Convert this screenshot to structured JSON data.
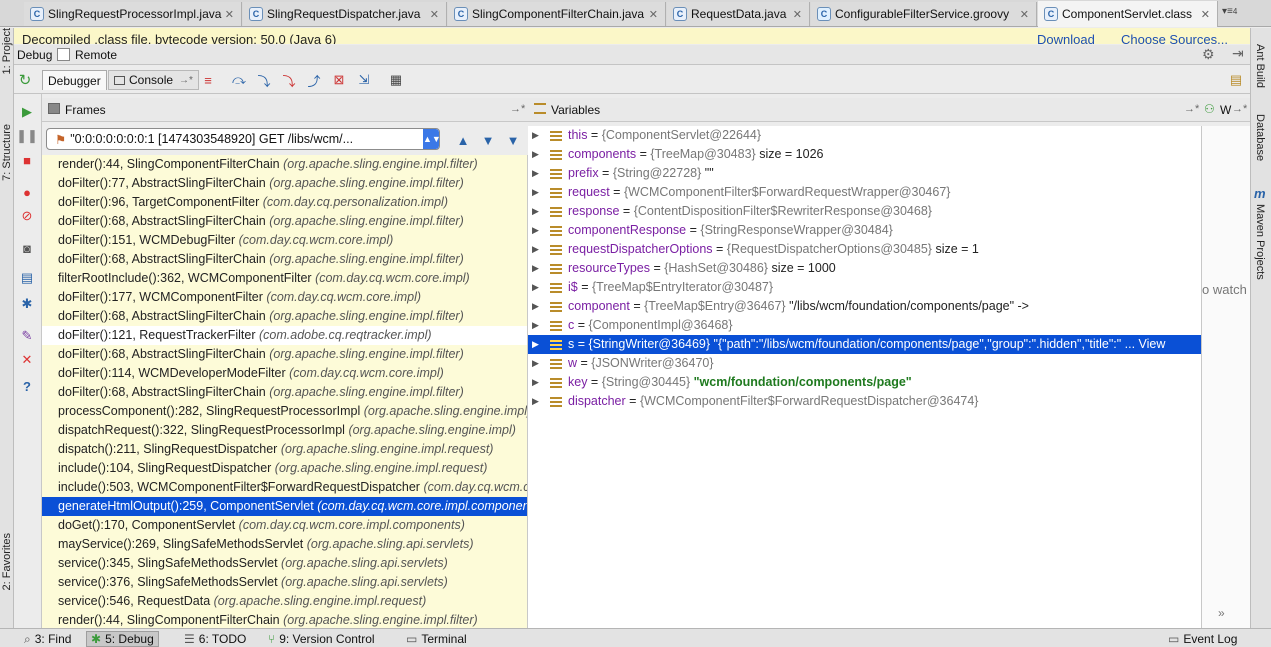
{
  "tabs": [
    {
      "label": "SlingRequestProcessorImpl.java",
      "icon": "class-icon",
      "active": false
    },
    {
      "label": "SlingRequestDispatcher.java",
      "icon": "class-icon",
      "active": false
    },
    {
      "label": "SlingComponentFilterChain.java",
      "icon": "class-icon",
      "active": false
    },
    {
      "label": "RequestData.java",
      "icon": "class-icon",
      "active": false
    },
    {
      "label": "ConfigurableFilterService.groovy",
      "icon": "groovy-class-icon",
      "active": false
    },
    {
      "label": "ComponentServlet.class",
      "icon": "class-file-icon",
      "active": true
    }
  ],
  "tab_overflow": "4",
  "banner": {
    "text": "Decompiled .class file, bytecode version: 50.0 (Java 6)",
    "download": "Download",
    "choose_sources": "Choose Sources..."
  },
  "left_strip": {
    "project": "1: Project",
    "structure": "7: Structure",
    "favorites": "2: Favorites"
  },
  "right_strip": {
    "ant": "Ant Build",
    "database": "Database",
    "maven": "Maven Projects"
  },
  "debug_header": {
    "label": "Debug",
    "config": "Remote"
  },
  "toolbar": {
    "debugger_tab": "Debugger",
    "console_tab": "Console"
  },
  "frames_panel": {
    "title": "Frames",
    "thread": "\"0:0:0:0:0:0:0:1 [1474303548920] GET /libs/wcm/...",
    "rows": [
      {
        "method": "render():44, SlingComponentFilterChain",
        "pkg": "(org.apache.sling.engine.impl.filter)"
      },
      {
        "method": "doFilter():77, AbstractSlingFilterChain",
        "pkg": "(org.apache.sling.engine.impl.filter)"
      },
      {
        "method": "doFilter():96, TargetComponentFilter",
        "pkg": "(com.day.cq.personalization.impl)"
      },
      {
        "method": "doFilter():68, AbstractSlingFilterChain",
        "pkg": "(org.apache.sling.engine.impl.filter)"
      },
      {
        "method": "doFilter():151, WCMDebugFilter",
        "pkg": "(com.day.cq.wcm.core.impl)"
      },
      {
        "method": "doFilter():68, AbstractSlingFilterChain",
        "pkg": "(org.apache.sling.engine.impl.filter)"
      },
      {
        "method": "filterRootInclude():362, WCMComponentFilter",
        "pkg": "(com.day.cq.wcm.core.impl)"
      },
      {
        "method": "doFilter():177, WCMComponentFilter",
        "pkg": "(com.day.cq.wcm.core.impl)"
      },
      {
        "method": "doFilter():68, AbstractSlingFilterChain",
        "pkg": "(org.apache.sling.engine.impl.filter)"
      },
      {
        "method": "doFilter():121, RequestTrackerFilter",
        "pkg": "(com.adobe.cq.reqtracker.impl)"
      },
      {
        "method": "doFilter():68, AbstractSlingFilterChain",
        "pkg": "(org.apache.sling.engine.impl.filter)"
      },
      {
        "method": "doFilter():114, WCMDeveloperModeFilter",
        "pkg": "(com.day.cq.wcm.core.impl)"
      },
      {
        "method": "doFilter():68, AbstractSlingFilterChain",
        "pkg": "(org.apache.sling.engine.impl.filter)"
      },
      {
        "method": "processComponent():282, SlingRequestProcessorImpl",
        "pkg": "(org.apache.sling.engine.impl)"
      },
      {
        "method": "dispatchRequest():322, SlingRequestProcessorImpl",
        "pkg": "(org.apache.sling.engine.impl)"
      },
      {
        "method": "dispatch():211, SlingRequestDispatcher",
        "pkg": "(org.apache.sling.engine.impl.request)"
      },
      {
        "method": "include():104, SlingRequestDispatcher",
        "pkg": "(org.apache.sling.engine.impl.request)"
      },
      {
        "method": "include():503, WCMComponentFilter$ForwardRequestDispatcher",
        "pkg": "(com.day.cq.wcm.core.impl)"
      },
      {
        "method": "generateHtmlOutput():259, ComponentServlet",
        "pkg": "(com.day.cq.wcm.core.impl.components)"
      },
      {
        "method": "doGet():170, ComponentServlet",
        "pkg": "(com.day.cq.wcm.core.impl.components)"
      },
      {
        "method": "mayService():269, SlingSafeMethodsServlet",
        "pkg": "(org.apache.sling.api.servlets)"
      },
      {
        "method": "service():345, SlingSafeMethodsServlet",
        "pkg": "(org.apache.sling.api.servlets)"
      },
      {
        "method": "service():376, SlingSafeMethodsServlet",
        "pkg": "(org.apache.sling.api.servlets)"
      },
      {
        "method": "service():546, RequestData",
        "pkg": "(org.apache.sling.engine.impl.request)"
      },
      {
        "method": "render():44, SlingComponentFilterChain",
        "pkg": "(org.apache.sling.engine.impl.filter)"
      }
    ],
    "selected_index": 18,
    "dim_index": 9
  },
  "variables_panel": {
    "title": "Variables",
    "watches_title": "W",
    "watches_hint": "o watch",
    "rows": [
      {
        "name": "this",
        "type": "{ComponentServlet@22644}",
        "value": ""
      },
      {
        "name": "components",
        "type": "{TreeMap@30483}",
        "value": " size = 1026"
      },
      {
        "name": "prefix",
        "type": "{String@22728}",
        "value": " \"\""
      },
      {
        "name": "request",
        "type": "{WCMComponentFilter$ForwardRequestWrapper@30467}",
        "value": ""
      },
      {
        "name": "response",
        "type": "{ContentDispositionFilter$RewriterResponse@30468}",
        "value": ""
      },
      {
        "name": "componentResponse",
        "type": "{StringResponseWrapper@30484}",
        "value": ""
      },
      {
        "name": "requestDispatcherOptions",
        "type": "{RequestDispatcherOptions@30485}",
        "value": " size = 1"
      },
      {
        "name": "resourceTypes",
        "type": "{HashSet@30486}",
        "value": " size = 1000"
      },
      {
        "name": "i$",
        "type": "{TreeMap$EntryIterator@30487}",
        "value": ""
      },
      {
        "name": "component",
        "type": "{TreeMap$Entry@36467}",
        "value": " \"/libs/wcm/foundation/components/page\" ->"
      },
      {
        "name": "c",
        "type": "{ComponentImpl@36468}",
        "value": ""
      },
      {
        "name": "s",
        "type": "{StringWriter@36469}",
        "value": " \"{\"path\":\"/libs/wcm/foundation/components/page\",\"group\":\".hidden\",\"title\":\" ... View"
      },
      {
        "name": "w",
        "type": "{JSONWriter@36470}",
        "value": ""
      },
      {
        "name": "key",
        "type": "{String@30445}",
        "value": " \"wcm/foundation/components/page\""
      },
      {
        "name": "dispatcher",
        "type": "{WCMComponentFilter$ForwardRequestDispatcher@36474}",
        "value": ""
      }
    ],
    "selected_index": 11,
    "string_value_index": 13
  },
  "statusbar": {
    "find": "3: Find",
    "debug": "5: Debug",
    "todo": "6: TODO",
    "vcs": "9: Version Control",
    "terminal": "Terminal",
    "event_log": "Event Log"
  }
}
